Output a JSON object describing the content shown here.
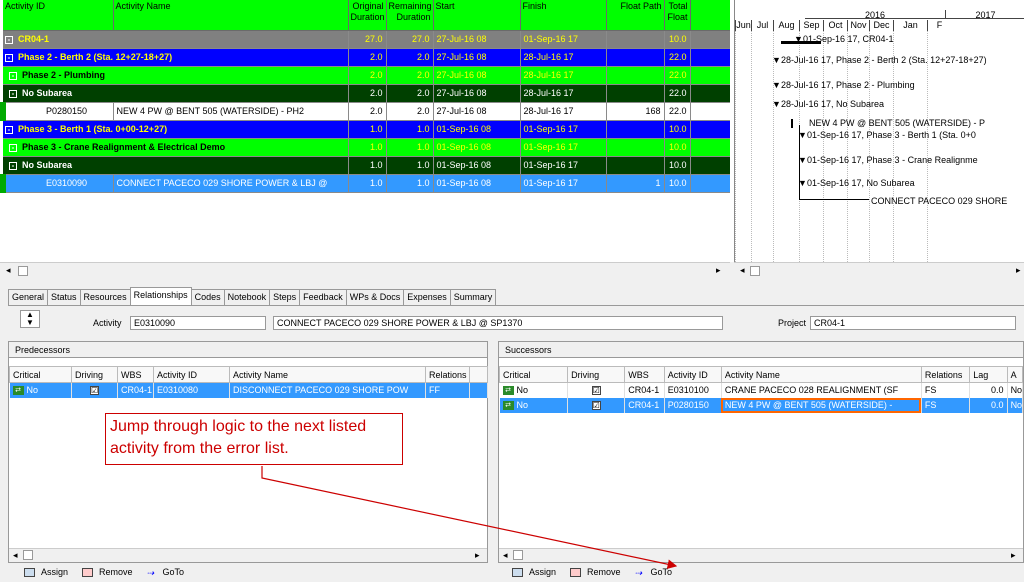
{
  "grid": {
    "headers": {
      "activity_id": "Activity ID",
      "activity_name": "Activity Name",
      "orig_dur": "Original Duration",
      "rem_dur": "Remaining Duration",
      "start": "Start",
      "finish": "Finish",
      "float_path": "Float Path",
      "total_float": "Total Float"
    },
    "rows": [
      {
        "type": "lvl1",
        "toggle": "-",
        "name": "CR04-1",
        "orig": "27.0",
        "rem": "27.0",
        "start": "27-Jul-16 08",
        "finish": "01-Sep-16 17",
        "fp": "",
        "tf": "10.0"
      },
      {
        "type": "lvl2",
        "toggle": "-",
        "name": "Phase 2 - Berth 2 (Sta. 12+27-18+27)",
        "orig": "2.0",
        "rem": "2.0",
        "start": "27-Jul-16 08",
        "finish": "28-Jul-16 17",
        "fp": "",
        "tf": "22.0"
      },
      {
        "type": "lvl3",
        "toggle": "-",
        "name": "Phase 2 - Plumbing",
        "orig": "2.0",
        "rem": "2.0",
        "start": "27-Jul-16 08",
        "finish": "28-Jul-16 17",
        "fp": "",
        "tf": "22.0"
      },
      {
        "type": "lvl4",
        "toggle": "-",
        "name": "No Subarea",
        "orig": "2.0",
        "rem": "2.0",
        "start": "27-Jul-16 08",
        "finish": "28-Jul-16 17",
        "fp": "",
        "tf": "22.0"
      },
      {
        "type": "act",
        "id": "P0280150",
        "name": "NEW 4 PW @ BENT 505 (WATERSIDE) - PH2",
        "orig": "2.0",
        "rem": "2.0",
        "start": "27-Jul-16 08",
        "finish": "28-Jul-16 17",
        "fp": "168",
        "tf": "22.0"
      },
      {
        "type": "lvl2",
        "toggle": "-",
        "name": "Phase 3 - Berth 1 (Sta. 0+00-12+27)",
        "orig": "1.0",
        "rem": "1.0",
        "start": "01-Sep-16 08",
        "finish": "01-Sep-16 17",
        "fp": "",
        "tf": "10.0"
      },
      {
        "type": "lvl3",
        "toggle": "-",
        "name": "Phase 3 - Crane Realignment & Electrical Demo",
        "orig": "1.0",
        "rem": "1.0",
        "start": "01-Sep-16 08",
        "finish": "01-Sep-16 17",
        "fp": "",
        "tf": "10.0"
      },
      {
        "type": "lvl4",
        "toggle": "-",
        "name": "No Subarea",
        "orig": "1.0",
        "rem": "1.0",
        "start": "01-Sep-16 08",
        "finish": "01-Sep-16 17",
        "fp": "",
        "tf": "10.0"
      },
      {
        "type": "sel",
        "id": "E0310090",
        "name": "CONNECT PACECO 029 SHORE POWER & LBJ @",
        "orig": "1.0",
        "rem": "1.0",
        "start": "01-Sep-16 08",
        "finish": "01-Sep-16 17",
        "fp": "1",
        "tf": "10.0"
      }
    ]
  },
  "gantt": {
    "years": [
      "2016",
      "2017"
    ],
    "months": [
      "Jun",
      "Jul",
      "Aug",
      "Sep",
      "Oct",
      "Nov",
      "Dec",
      "Jan",
      "F"
    ],
    "labels": [
      "01-Sep-16 17, CR04-1",
      "28-Jul-16 17, Phase 2 - Berth 2 (Sta. 12+27-18+27)",
      "28-Jul-16 17, Phase 2 - Plumbing",
      "28-Jul-16 17, No Subarea",
      "NEW 4 PW @ BENT 505 (WATERSIDE) - P",
      "01-Sep-16 17, Phase 3 - Berth 1 (Sta. 0+0",
      "01-Sep-16 17, Phase 3 - Crane Realignme",
      "01-Sep-16 17, No Subarea",
      "CONNECT PACECO 029 SHORE"
    ]
  },
  "tabs": [
    "General",
    "Status",
    "Resources",
    "Relationships",
    "Codes",
    "Notebook",
    "Steps",
    "Feedback",
    "WPs & Docs",
    "Expenses",
    "Summary"
  ],
  "active_tab": "Relationships",
  "detail": {
    "activity_label": "Activity",
    "activity_id": "E0310090",
    "activity_name": "CONNECT PACECO 029 SHORE POWER & LBJ @ SP1370",
    "project_label": "Project",
    "project": "CR04-1"
  },
  "predecessors": {
    "title": "Predecessors",
    "headers": [
      "Critical",
      "Driving",
      "WBS",
      "Activity ID",
      "Activity Name",
      "Relations"
    ],
    "rows": [
      {
        "critical": "No",
        "driving": "☑",
        "wbs": "CR04-1",
        "id": "E0310080",
        "name": "DISCONNECT PACECO 029 SHORE POW",
        "rel": "FF"
      }
    ]
  },
  "successors": {
    "title": "Successors",
    "headers": [
      "Critical",
      "Driving",
      "WBS",
      "Activity ID",
      "Activity Name",
      "Relations",
      "Lag",
      "A"
    ],
    "rows": [
      {
        "critical": "No",
        "driving": "☑",
        "wbs": "CR04-1",
        "id": "E0310100",
        "name": "CRANE PACECO 028 REALIGNMENT (SF",
        "rel": "FS",
        "lag": "0.0",
        "a": "No"
      },
      {
        "critical": "No",
        "driving": "☑",
        "wbs": "CR04-1",
        "id": "P0280150",
        "name": "NEW 4 PW @ BENT 505 (WATERSIDE) -",
        "rel": "FS",
        "lag": "0.0",
        "a": "No"
      }
    ]
  },
  "buttons": {
    "assign": "Assign",
    "remove": "Remove",
    "goto": "GoTo"
  },
  "callout": "Jump through logic to the next listed activity from the error list.",
  "colors": {
    "header_green": "#00ff00",
    "wbs_blue": "#0000ff",
    "selection": "#3399ff",
    "callout_red": "#cc0000"
  }
}
